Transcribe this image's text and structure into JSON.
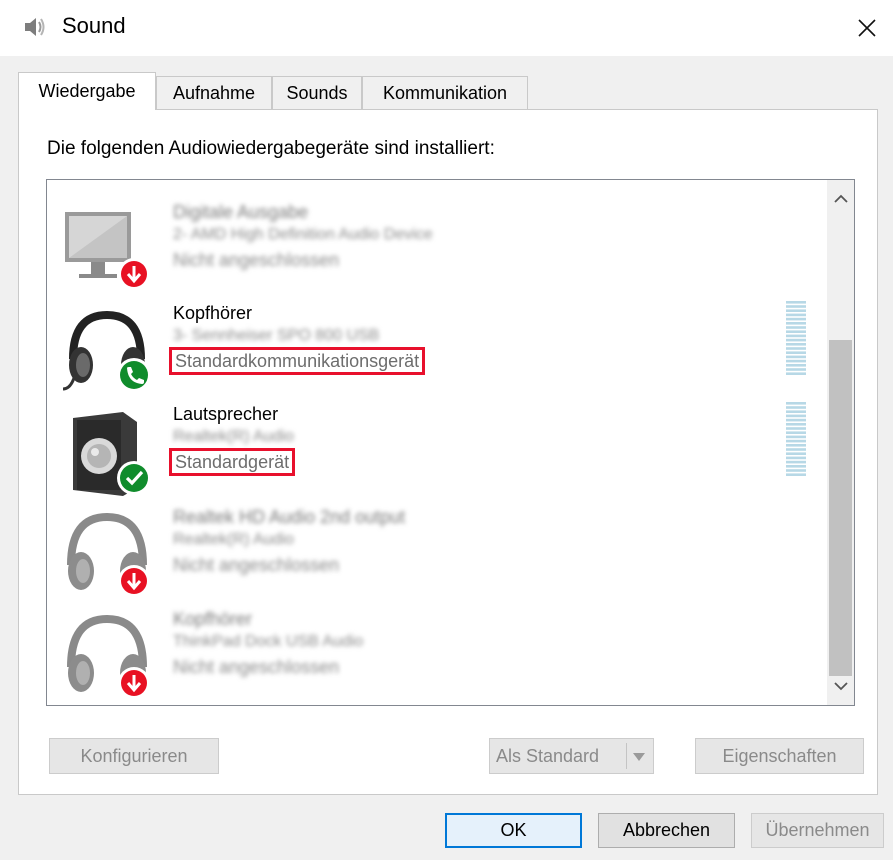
{
  "window": {
    "title": "Sound"
  },
  "tabs": [
    "Wiedergabe",
    "Aufnahme",
    "Sounds",
    "Kommunikation"
  ],
  "heading": "Die folgenden Audiowiedergabegeräte sind installiert:",
  "devices": [
    {
      "name": "Digitale Ausgabe",
      "description": "2- AMD High Definition Audio Device",
      "status": "Nicht angeschlossen",
      "icon": "monitor-icon",
      "badge": "unplugged"
    },
    {
      "name": "Kopfhörer",
      "description": "3- Sennheiser SPO 800 USB",
      "status": "Standardkommunikationsgerät",
      "icon": "headset-icon",
      "badge": "phone-default"
    },
    {
      "name": "Lautsprecher",
      "description": "Realtek(R) Audio",
      "status": "Standardgerät",
      "icon": "speaker-icon",
      "badge": "default-check"
    },
    {
      "name": "Realtek HD Audio 2nd output",
      "description": "Realtek(R) Audio",
      "status": "Nicht angeschlossen",
      "icon": "headphones-icon",
      "badge": "unplugged"
    },
    {
      "name": "Kopfhörer",
      "description": "ThinkPad Dock USB Audio",
      "status": "Nicht angeschlossen",
      "icon": "headphones-icon",
      "badge": "unplugged"
    }
  ],
  "buttons": {
    "configure": "Konfigurieren",
    "set_default": "Als Standard",
    "properties": "Eigenschaften",
    "ok": "OK",
    "cancel": "Abbrechen",
    "apply": "Übernehmen"
  },
  "colors": {
    "highlight": "#e8102c",
    "accent": "#0078d7",
    "meter": "#b7d8e6"
  }
}
